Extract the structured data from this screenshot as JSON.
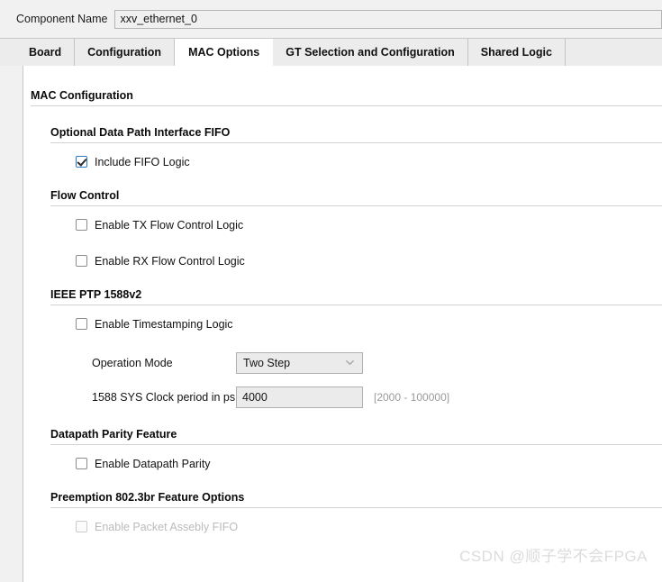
{
  "header": {
    "component_name_label": "Component Name",
    "component_name_value": "xxv_ethernet_0"
  },
  "tabs": [
    {
      "label": "Board",
      "active": false
    },
    {
      "label": "Configuration",
      "active": false
    },
    {
      "label": "MAC Options",
      "active": true
    },
    {
      "label": "GT Selection and Configuration",
      "active": false
    },
    {
      "label": "Shared Logic",
      "active": false
    }
  ],
  "main": {
    "title": "MAC Configuration",
    "sections": [
      {
        "title": "Optional Data Path Interface FIFO",
        "checkboxes": [
          {
            "label": "Include FIFO Logic",
            "checked": true,
            "disabled": false
          }
        ]
      },
      {
        "title": "Flow Control",
        "checkboxes": [
          {
            "label": "Enable TX Flow Control Logic",
            "checked": false,
            "disabled": false
          },
          {
            "label": "Enable RX Flow Control Logic",
            "checked": false,
            "disabled": false
          }
        ]
      },
      {
        "title": "IEEE PTP 1588v2",
        "checkboxes": [
          {
            "label": "Enable Timestamping Logic",
            "checked": false,
            "disabled": false
          }
        ],
        "fields": [
          {
            "type": "combo",
            "label": "Operation Mode",
            "value": "Two Step",
            "hint": ""
          },
          {
            "type": "text",
            "label": "1588 SYS Clock period in ps",
            "value": "4000",
            "hint": "[2000 - 100000]"
          }
        ]
      },
      {
        "title": "Datapath Parity Feature",
        "checkboxes": [
          {
            "label": "Enable Datapath Parity",
            "checked": false,
            "disabled": false
          }
        ]
      },
      {
        "title": "Preemption 802.3br Feature Options",
        "checkboxes": [
          {
            "label": "Enable Packet Assebly FIFO",
            "checked": false,
            "disabled": true
          }
        ]
      }
    ]
  },
  "watermark": "CSDN @顺子学不会FPGA",
  "colors": {
    "accent": "#2a78c8",
    "panel_bg": "#ffffff",
    "chrome_bg": "#f1f1f1",
    "field_bg": "#ebebeb",
    "rule": "#d2d2d2"
  }
}
